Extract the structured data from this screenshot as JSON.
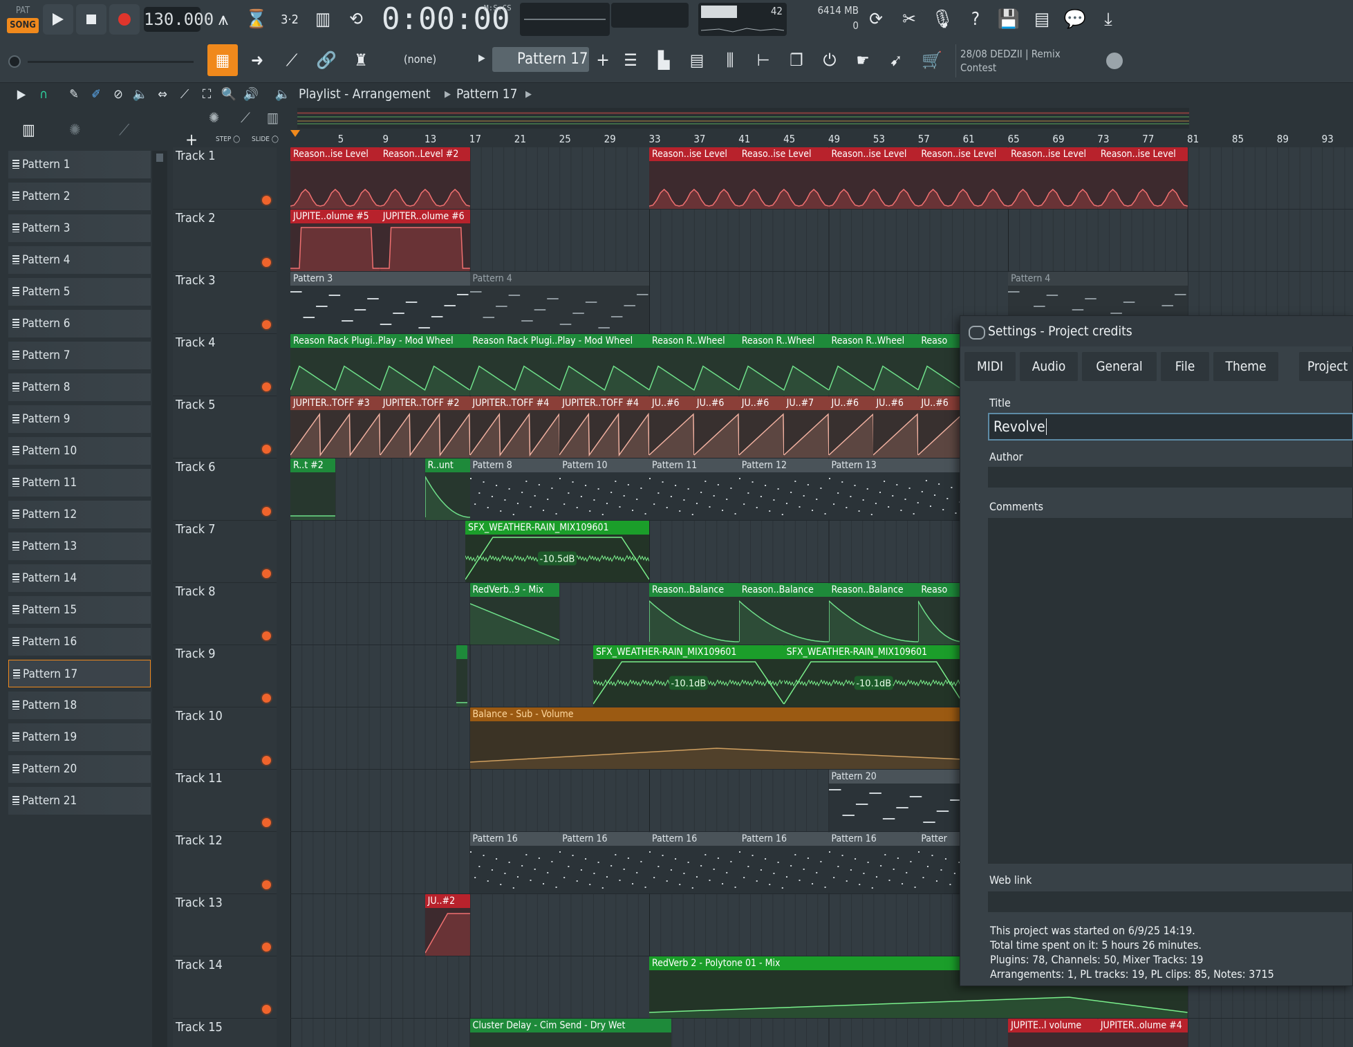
{
  "transport": {
    "pat_label": "PAT",
    "song_label": "SONG",
    "tempo": "130.000",
    "time": "0:00:00",
    "time_format": "M:S:CS",
    "meter_value": "42",
    "ram": "6414 MB",
    "polyphony": "0"
  },
  "toolbar": {
    "preset": "(none)",
    "pattern_selector": "Pattern 17",
    "hint_line1": "28/08  DEDZII | Remix",
    "hint_line2": "Contest"
  },
  "playlist": {
    "title": "Playlist - Arrangement",
    "crumb": "Pattern 17",
    "step_label": "STEP",
    "slide_label": "SLIDE",
    "bars": [
      "5",
      "9",
      "13",
      "17",
      "21",
      "25",
      "29",
      "33",
      "37",
      "41",
      "45",
      "49",
      "53",
      "57",
      "61",
      "65",
      "69",
      "73",
      "77",
      "81",
      "85",
      "89",
      "93"
    ]
  },
  "patterns": [
    "Pattern 1",
    "Pattern 2",
    "Pattern 3",
    "Pattern 4",
    "Pattern 5",
    "Pattern 6",
    "Pattern 7",
    "Pattern 8",
    "Pattern 9",
    "Pattern 10",
    "Pattern 11",
    "Pattern 12",
    "Pattern 13",
    "Pattern 14",
    "Pattern 15",
    "Pattern 16",
    "Pattern 17",
    "Pattern 18",
    "Pattern 19",
    "Pattern 20",
    "Pattern 21"
  ],
  "selected_pattern": "Pattern 17",
  "tracks": [
    "Track 1",
    "Track 2",
    "Track 3",
    "Track 4",
    "Track 5",
    "Track 6",
    "Track 7",
    "Track 8",
    "Track 9",
    "Track 10",
    "Track 11",
    "Track 12",
    "Track 13",
    "Track 14",
    "Track 15"
  ],
  "clips": [
    {
      "row": 0,
      "from": 1,
      "to": 9,
      "color": "red",
      "label": "Reason..ise Level",
      "shape": "bumps"
    },
    {
      "row": 0,
      "from": 9,
      "to": 17,
      "color": "red",
      "label": "Reason..Level #2",
      "shape": "bumps"
    },
    {
      "row": 0,
      "from": 33,
      "to": 41,
      "color": "red",
      "label": "Reason..ise Level",
      "shape": "bumps"
    },
    {
      "row": 0,
      "from": 41,
      "to": 49,
      "color": "red",
      "label": "Reaso..ise Level",
      "shape": "bumps"
    },
    {
      "row": 0,
      "from": 49,
      "to": 57,
      "color": "red",
      "label": "Reason..ise Level",
      "shape": "bumps"
    },
    {
      "row": 0,
      "from": 57,
      "to": 65,
      "color": "red",
      "label": "Reason..ise Level",
      "shape": "bumps"
    },
    {
      "row": 0,
      "from": 65,
      "to": 73,
      "color": "red",
      "label": "Reason..ise Level",
      "shape": "bumps"
    },
    {
      "row": 0,
      "from": 73,
      "to": 81,
      "color": "red",
      "label": "Reason..ise Level",
      "shape": "bumps"
    },
    {
      "row": 1,
      "from": 1,
      "to": 9,
      "color": "red",
      "label": "JUPITE..olume #5",
      "shape": "gate"
    },
    {
      "row": 1,
      "from": 9,
      "to": 17,
      "color": "red",
      "label": "JUPITER..olume #6",
      "shape": "gate"
    },
    {
      "row": 2,
      "from": 1,
      "to": 17,
      "color": "gray",
      "label": "Pattern 3",
      "shape": "notes"
    },
    {
      "row": 2,
      "from": 17,
      "to": 33,
      "color": "dgray",
      "label": "Pattern 4",
      "shape": "notes"
    },
    {
      "row": 2,
      "from": 65,
      "to": 81,
      "color": "dgray",
      "label": "Pattern 4",
      "shape": "notes"
    },
    {
      "row": 3,
      "from": 1,
      "to": 17,
      "color": "green",
      "label": "Reason Rack Plugi..Play - Mod Wheel",
      "shape": "wheel"
    },
    {
      "row": 3,
      "from": 17,
      "to": 33,
      "color": "green",
      "label": "Reason Rack Plugi..Play - Mod Wheel",
      "shape": "wheel"
    },
    {
      "row": 3,
      "from": 33,
      "to": 41,
      "color": "green",
      "label": "Reason R..Wheel",
      "shape": "wheel"
    },
    {
      "row": 3,
      "from": 41,
      "to": 49,
      "color": "green",
      "label": "Reason R..Wheel",
      "shape": "wheel"
    },
    {
      "row": 3,
      "from": 49,
      "to": 57,
      "color": "green",
      "label": "Reason R..Wheel",
      "shape": "wheel"
    },
    {
      "row": 3,
      "from": 57,
      "to": 65,
      "color": "green",
      "label": "Reaso",
      "shape": "wheel"
    },
    {
      "row": 4,
      "from": 1,
      "to": 9,
      "color": "salmon",
      "label": "JUPITER..TOFF #3",
      "shape": "saw"
    },
    {
      "row": 4,
      "from": 9,
      "to": 17,
      "color": "salmon",
      "label": "JUPITER..TOFF #2",
      "shape": "saw"
    },
    {
      "row": 4,
      "from": 17,
      "to": 25,
      "color": "salmon",
      "label": "JUPITER..TOFF #4",
      "shape": "saw"
    },
    {
      "row": 4,
      "from": 25,
      "to": 33,
      "color": "salmon",
      "label": "JUPITER..TOFF #4",
      "shape": "saw"
    },
    {
      "row": 4,
      "from": 33,
      "to": 37,
      "color": "salmon",
      "label": "JU..#6",
      "shape": "saw"
    },
    {
      "row": 4,
      "from": 37,
      "to": 41,
      "color": "salmon",
      "label": "JU..#6",
      "shape": "saw"
    },
    {
      "row": 4,
      "from": 41,
      "to": 45,
      "color": "salmon",
      "label": "JU..#6",
      "shape": "saw"
    },
    {
      "row": 4,
      "from": 45,
      "to": 49,
      "color": "salmon",
      "label": "JU..#7",
      "shape": "saw"
    },
    {
      "row": 4,
      "from": 49,
      "to": 53,
      "color": "salmon",
      "label": "JU..#6",
      "shape": "saw"
    },
    {
      "row": 4,
      "from": 53,
      "to": 57,
      "color": "salmon",
      "label": "JU..#6",
      "shape": "saw"
    },
    {
      "row": 4,
      "from": 57,
      "to": 61,
      "color": "salmon",
      "label": "JU..#6",
      "shape": "saw"
    },
    {
      "row": 5,
      "from": 1,
      "to": 5,
      "color": "green",
      "label": "R..t #2",
      "shape": "flat"
    },
    {
      "row": 5,
      "from": 13,
      "to": 17,
      "color": "green",
      "label": "R..unt",
      "shape": "decay"
    },
    {
      "row": 5,
      "from": 17,
      "to": 25,
      "color": "gray",
      "label": "Pattern 8",
      "shape": "dots"
    },
    {
      "row": 5,
      "from": 25,
      "to": 33,
      "color": "gray",
      "label": "Pattern 10",
      "shape": "dots"
    },
    {
      "row": 5,
      "from": 33,
      "to": 41,
      "color": "gray",
      "label": "Pattern 11",
      "shape": "dots"
    },
    {
      "row": 5,
      "from": 41,
      "to": 49,
      "color": "gray",
      "label": "Pattern 12",
      "shape": "dots"
    },
    {
      "row": 5,
      "from": 49,
      "to": 61,
      "color": "gray",
      "label": "Pattern 13",
      "shape": "dots"
    },
    {
      "row": 6,
      "from": 16.6,
      "to": 33,
      "color": "bgreen",
      "label": "SFX_WEATHER-RAIN_MIX109601",
      "shape": "audio",
      "gain": "-10.5dB"
    },
    {
      "row": 7,
      "from": 17,
      "to": 25,
      "color": "green",
      "label": "RedVerb..9 - Mix",
      "shape": "ramp"
    },
    {
      "row": 7,
      "from": 33,
      "to": 41,
      "color": "green",
      "label": "Reason..Balance",
      "shape": "decay"
    },
    {
      "row": 7,
      "from": 41,
      "to": 49,
      "color": "green",
      "label": "Reason..Balance",
      "shape": "decay"
    },
    {
      "row": 7,
      "from": 49,
      "to": 57,
      "color": "green",
      "label": "Reason..Balance",
      "shape": "decay"
    },
    {
      "row": 7,
      "from": 57,
      "to": 61,
      "color": "green",
      "label": "Reaso",
      "shape": "decay"
    },
    {
      "row": 8,
      "from": 15.8,
      "to": 16.8,
      "color": "green",
      "label": "",
      "shape": "flat"
    },
    {
      "row": 8,
      "from": 28,
      "to": 45,
      "color": "bgreen",
      "label": "SFX_WEATHER-RAIN_MIX109601",
      "shape": "audio",
      "gain": "-10.1dB"
    },
    {
      "row": 8,
      "from": 45,
      "to": 61,
      "color": "bgreen",
      "label": "SFX_WEATHER-RAIN_MIX109601",
      "shape": "audio",
      "gain": "-10.1dB"
    },
    {
      "row": 9,
      "from": 17,
      "to": 61,
      "color": "orange",
      "label": "Balance - Sub - Volume",
      "shape": "swell"
    },
    {
      "row": 10,
      "from": 49,
      "to": 61,
      "color": "gray",
      "label": "Pattern 20",
      "shape": "notes"
    },
    {
      "row": 11,
      "from": 17,
      "to": 25,
      "color": "gray",
      "label": "Pattern 16",
      "shape": "dots"
    },
    {
      "row": 11,
      "from": 25,
      "to": 33,
      "color": "gray",
      "label": "Pattern 16",
      "shape": "dots"
    },
    {
      "row": 11,
      "from": 33,
      "to": 41,
      "color": "gray",
      "label": "Pattern 16",
      "shape": "dots"
    },
    {
      "row": 11,
      "from": 41,
      "to": 49,
      "color": "gray",
      "label": "Pattern 16",
      "shape": "dots"
    },
    {
      "row": 11,
      "from": 49,
      "to": 57,
      "color": "gray",
      "label": "Pattern 16",
      "shape": "dots"
    },
    {
      "row": 11,
      "from": 57,
      "to": 61,
      "color": "gray",
      "label": "Patter",
      "shape": "dots"
    },
    {
      "row": 12,
      "from": 13,
      "to": 17,
      "color": "red",
      "label": "JU..#2",
      "shape": "rise"
    },
    {
      "row": 13,
      "from": 33,
      "to": 81,
      "color": "bgreen",
      "label": "RedVerb 2 - Polytone 01 - Mix",
      "shape": "slope"
    },
    {
      "row": 14,
      "from": 17,
      "to": 35,
      "color": "green",
      "label": "Cluster Delay - Cim Send - Dry Wet",
      "shape": "flat"
    },
    {
      "row": 14,
      "from": 65,
      "to": 73,
      "color": "red",
      "label": "JUPITE..l volume",
      "shape": "flat"
    },
    {
      "row": 14,
      "from": 73,
      "to": 81,
      "color": "red",
      "label": "JUPITER..olume #4",
      "shape": "flat"
    }
  ],
  "settings": {
    "title": "Settings - Project credits",
    "tabs": [
      "MIDI",
      "Audio",
      "General",
      "File",
      "Theme",
      "Project"
    ],
    "title_label": "Title",
    "title_value": "Revolve",
    "author_label": "Author",
    "author_value": "",
    "comments_label": "Comments",
    "weblink_label": "Web link",
    "info": [
      "This project was started on 6/9/25 14:19.",
      "Total time spent on it:  5 hours 26 minutes.",
      "Plugins: 78, Channels: 50, Mixer Tracks: 19",
      "Arrangements: 1, PL tracks: 19, PL clips: 85, Notes: 3715"
    ]
  },
  "colors": {
    "accent": "#f0891c",
    "record": "#e0352c",
    "clip_red": "#b8222c",
    "clip_green": "#1e8a3a",
    "clip_orange": "#9b5a12"
  }
}
